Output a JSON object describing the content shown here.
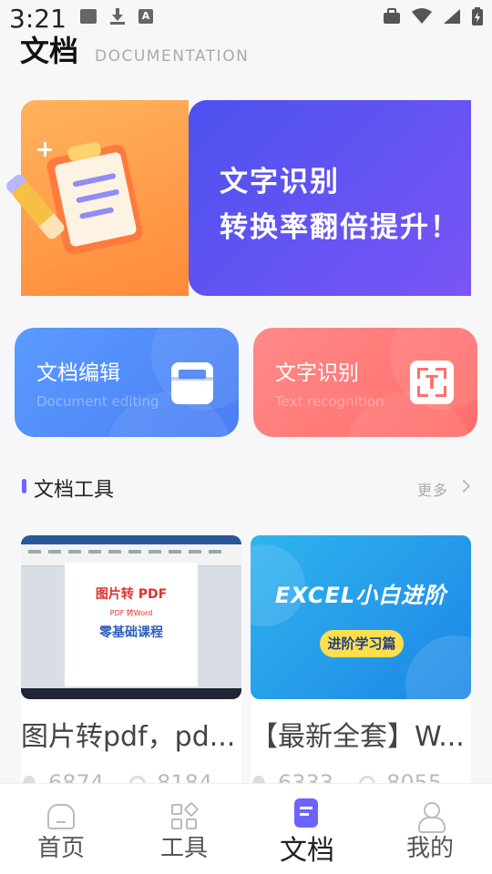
{
  "status_bar": {
    "time": "3:21",
    "notify_letter": "A"
  },
  "header": {
    "title": "文档",
    "subtitle": "DOCUMENTATION"
  },
  "banner": {
    "line1": "文字识别",
    "line2": "转换率翻倍提升！"
  },
  "features": [
    {
      "title": "文档编辑",
      "subtitle": "Document editing",
      "color": "#4b7ef4"
    },
    {
      "title": "文字识别",
      "subtitle": "Text recognition",
      "color": "#ff6d6b"
    }
  ],
  "section": {
    "title": "文档工具",
    "more": "更多"
  },
  "articles": [
    {
      "thumb": {
        "line1": "图片转 PDF",
        "line2": "PDF 转Word",
        "line3": "零基础课程"
      },
      "title": "图片转pdf，pd...",
      "likes": "6874",
      "views": "8184"
    },
    {
      "thumb": {
        "line1": "EXCEL小白进阶",
        "line2": "进阶学习篇"
      },
      "title": "【最新全套】W...",
      "likes": "6333",
      "views": "8055"
    }
  ],
  "nav": {
    "items": [
      {
        "label": "首页",
        "icon": "home-icon"
      },
      {
        "label": "工具",
        "icon": "tools-icon"
      },
      {
        "label": "文档",
        "icon": "document-icon",
        "active": true
      },
      {
        "label": "我的",
        "icon": "profile-icon"
      }
    ],
    "accent": "#6f63ff"
  }
}
